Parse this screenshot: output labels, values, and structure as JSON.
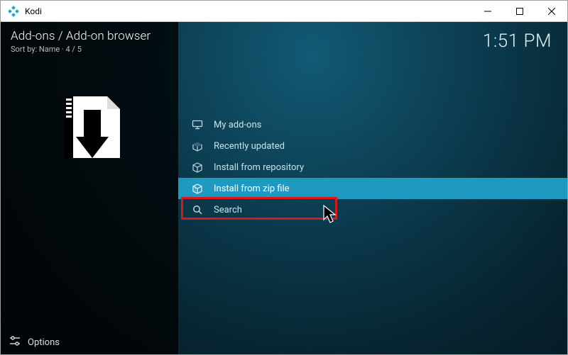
{
  "window": {
    "app_title": "Kodi",
    "controls": {
      "minimize": "—",
      "maximize": "☐",
      "close": "✕"
    }
  },
  "header": {
    "breadcrumb": "Add-ons / Add-on browser",
    "sort_prefix": "Sort by:",
    "sort_value": "Name",
    "position": "4 / 5"
  },
  "clock": "1:51 PM",
  "menu": {
    "items": [
      {
        "label": "My add-ons",
        "icon": "monitor-icon",
        "selected": false
      },
      {
        "label": "Recently updated",
        "icon": "box-open-icon",
        "selected": false
      },
      {
        "label": "Install from repository",
        "icon": "box-icon",
        "selected": false
      },
      {
        "label": "Install from zip file",
        "icon": "zip-box-icon",
        "selected": true
      },
      {
        "label": "Search",
        "icon": "search-icon",
        "selected": false
      }
    ]
  },
  "footer": {
    "options_label": "Options"
  }
}
